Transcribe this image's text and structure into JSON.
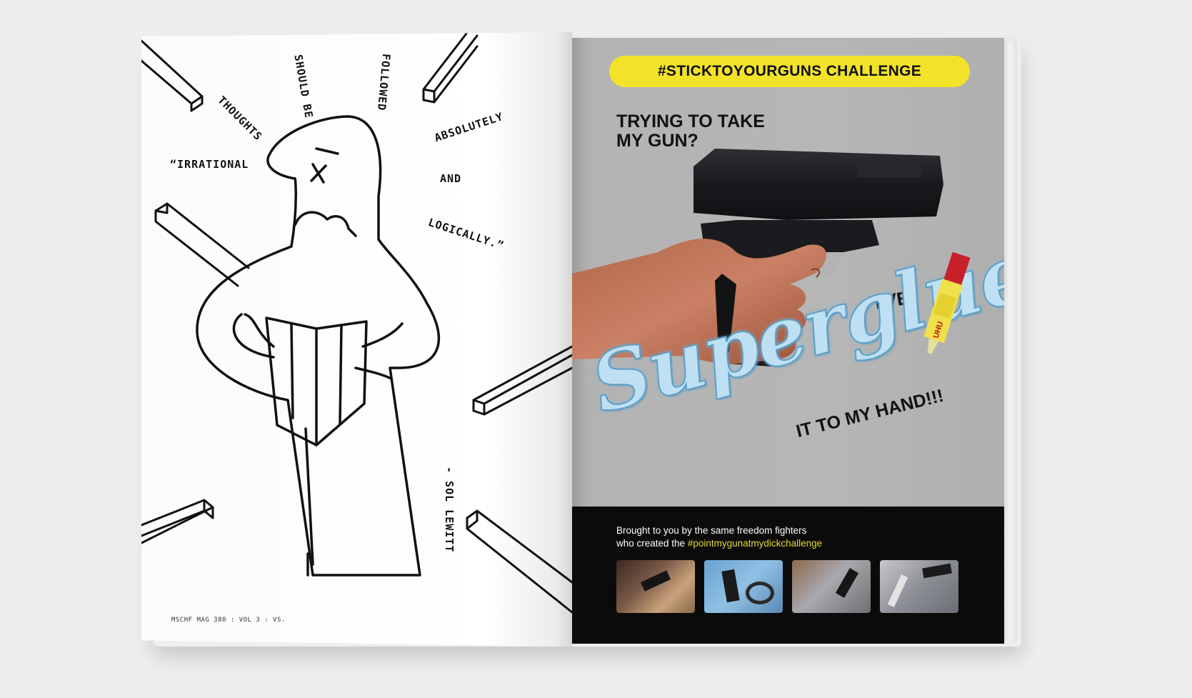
{
  "left_page": {
    "quote_words": {
      "irrational": "“IRRATIONAL",
      "thoughts": "THOUGHTS",
      "should_be": "SHOULD BE",
      "followed": "FOLLOWED",
      "absolutely": "ABSOLUTELY",
      "and": "AND",
      "logically": "LOGICALLY.”"
    },
    "attribution": "- SOL LEWITT",
    "footer": "MSCHF MAG 380 : VOL 3 : VS."
  },
  "right_page": {
    "banner": "#STICKTOYOURGUNS CHALLENGE",
    "headline_line1": "TRYING TO TAKE",
    "headline_line2": "MY GUN?",
    "ive": "I'VE",
    "script_word": "Superglued",
    "tail": "IT TO MY HAND!!!",
    "credits_line1": "Brought to you by the same freedom fighters",
    "credits_line2_prefix": "who created the ",
    "credits_hashtag": "#pointmygunatmydickchallenge",
    "glue_label": "UHU",
    "colors": {
      "banner": "#f2e32a",
      "page_gray": "#b3b3b3",
      "band": "#0b0b0b",
      "hashtag": "#e8d738",
      "glue_blue": "#bfe0f3"
    }
  }
}
